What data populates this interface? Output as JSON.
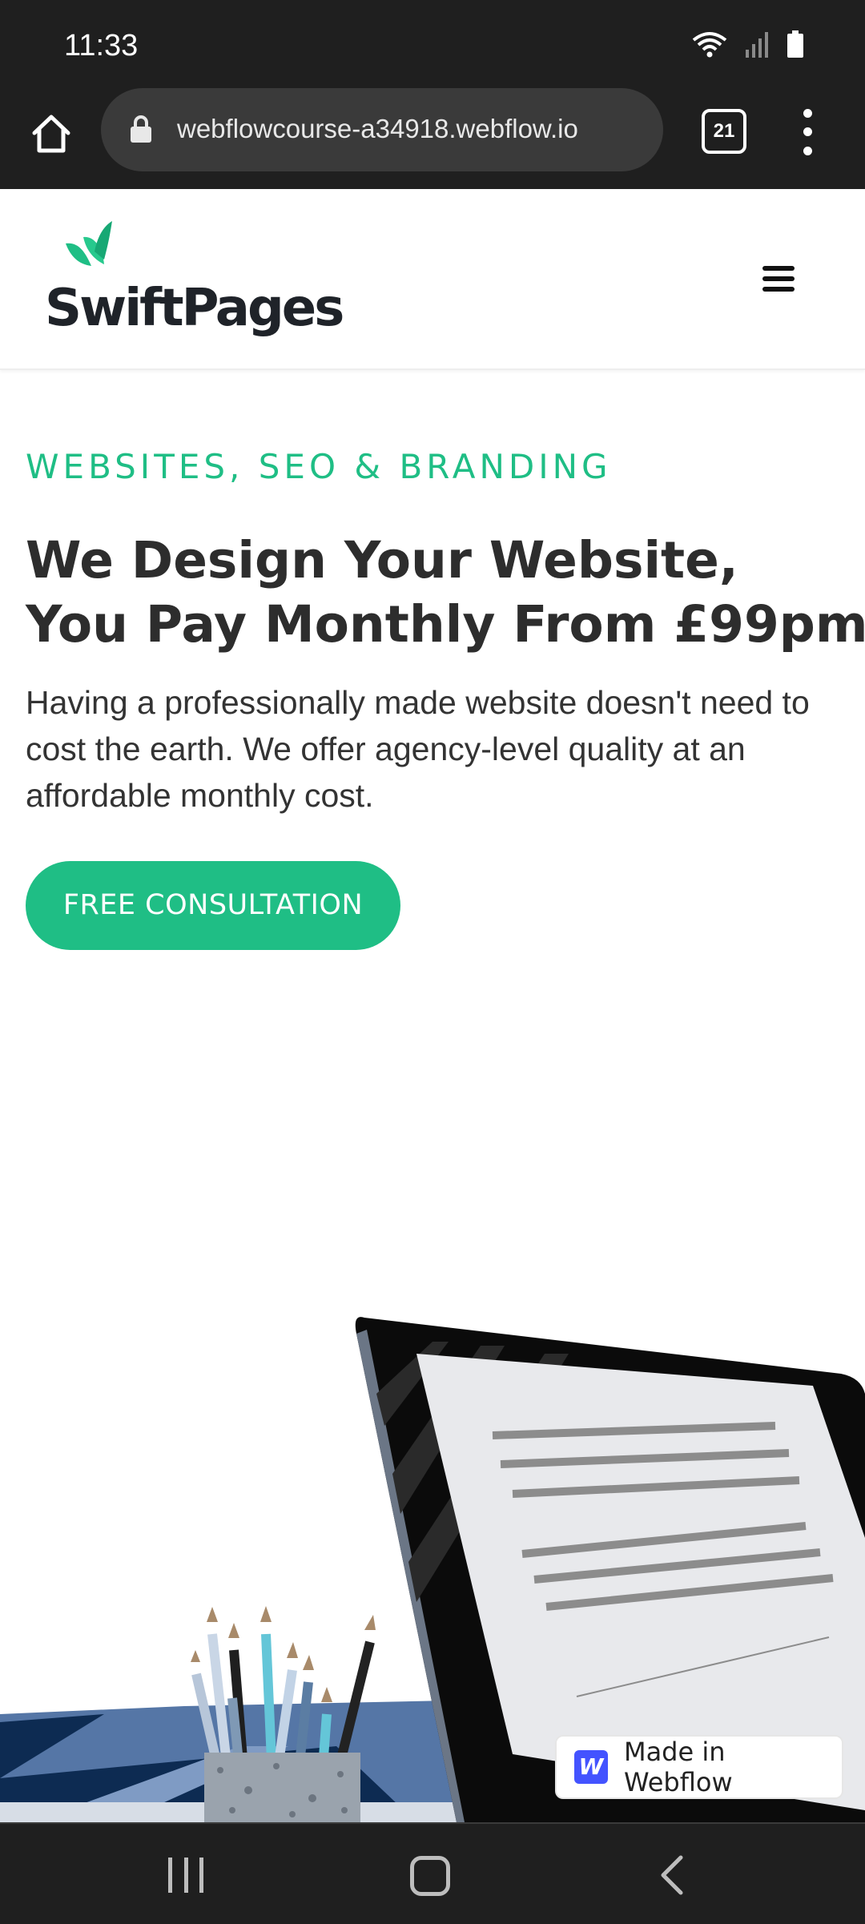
{
  "status_bar": {
    "time": "11:33"
  },
  "browser": {
    "url": "webflowcourse-a34918.webflow.io",
    "tab_count": "21"
  },
  "site": {
    "brand": "SwiftPages"
  },
  "hero": {
    "eyebrow": "WEBSITES, SEO & BRANDING",
    "headline_line1": "We Design Your Website,",
    "headline_line2": "You Pay Monthly From £99pm",
    "body": "Having a professionally made website doesn't need to cost the earth. We offer agency-level quality at an affordable monthly cost.",
    "cta_label": "FREE CONSULTATION"
  },
  "badge": {
    "logo_letter": "W",
    "label": "Made in Webflow"
  },
  "colors": {
    "accent": "#1fbe85",
    "headline": "#2d2d2d",
    "system_bar": "#1f1f1f",
    "webflow_blue": "#4353ff"
  }
}
